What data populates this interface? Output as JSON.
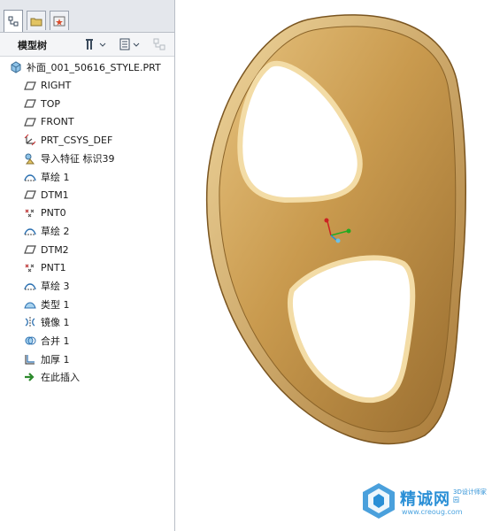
{
  "panel": {
    "title": "模型树",
    "tabs": [
      {
        "icon": "model-tree-icon",
        "active": true
      },
      {
        "icon": "folder-browser-icon",
        "active": false
      },
      {
        "icon": "favorites-icon",
        "active": false
      }
    ],
    "header_buttons": [
      "show-tools-icon",
      "settings-icon"
    ]
  },
  "tree": {
    "items": [
      {
        "label": "补面_001_50616_STYLE.PRT",
        "icon": "part-icon"
      },
      {
        "label": "RIGHT",
        "icon": "datum-plane-icon"
      },
      {
        "label": "TOP",
        "icon": "datum-plane-icon"
      },
      {
        "label": "FRONT",
        "icon": "datum-plane-icon"
      },
      {
        "label": "PRT_CSYS_DEF",
        "icon": "csys-icon"
      },
      {
        "label": "导入特征 标识39",
        "icon": "import-feature-icon"
      },
      {
        "label": "草绘 1",
        "icon": "sketch-icon"
      },
      {
        "label": "DTM1",
        "icon": "datum-plane-icon"
      },
      {
        "label": "PNT0",
        "icon": "datum-point-icon"
      },
      {
        "label": "草绘 2",
        "icon": "sketch-icon"
      },
      {
        "label": "DTM2",
        "icon": "datum-plane-icon"
      },
      {
        "label": "PNT1",
        "icon": "datum-point-icon"
      },
      {
        "label": "草绘 3",
        "icon": "sketch-icon"
      },
      {
        "label": "类型 1",
        "icon": "style-surface-icon"
      },
      {
        "label": "镜像 1",
        "icon": "mirror-icon"
      },
      {
        "label": "合并 1",
        "icon": "merge-icon"
      },
      {
        "label": "加厚 1",
        "icon": "thicken-icon"
      },
      {
        "label": "在此插入",
        "icon": "insert-here-arrow-icon"
      }
    ]
  },
  "colors": {
    "model_body": "#c99a4e",
    "model_highlight": "#e8c887",
    "model_shadow": "#8a6328",
    "accent_blue": "#2a8fd6",
    "insert_arrow": "#2d8a2d"
  },
  "watermark": {
    "name": "精诚网",
    "sub": "3D设计师家园",
    "url": "www.creoug.com"
  }
}
